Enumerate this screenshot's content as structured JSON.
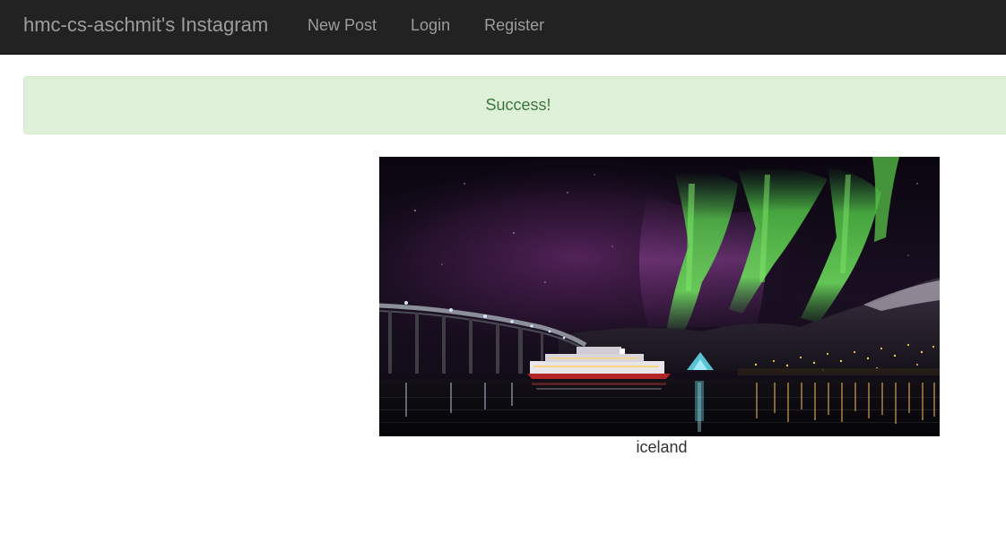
{
  "navbar": {
    "brand": "hmc-cs-aschmit's Instagram",
    "links": [
      {
        "label": "New Post"
      },
      {
        "label": "Login"
      },
      {
        "label": "Register"
      }
    ]
  },
  "alert": {
    "message": "Success!"
  },
  "post": {
    "caption": "iceland"
  },
  "colors": {
    "navbar_bg": "#222222",
    "nav_text": "#9d9d9d",
    "alert_bg": "#dff0d8",
    "alert_text": "#3c763d",
    "aurora_green": "#5fcf48",
    "aurora_purple": "#6a2a72"
  }
}
